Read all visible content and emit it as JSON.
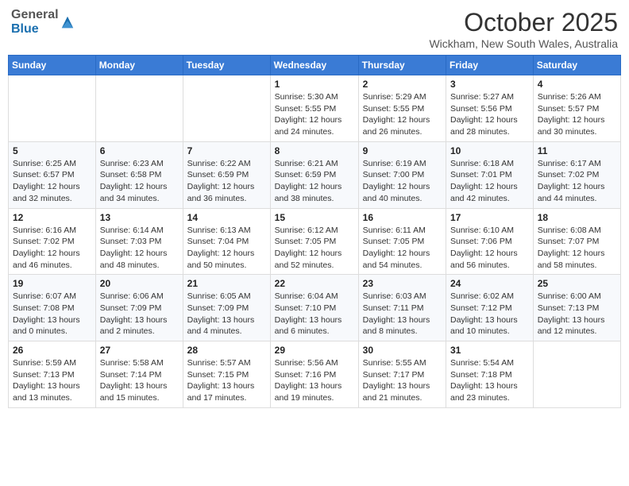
{
  "header": {
    "logo": {
      "general": "General",
      "blue": "Blue"
    },
    "title": "October 2025",
    "location": "Wickham, New South Wales, Australia"
  },
  "weekdays": [
    "Sunday",
    "Monday",
    "Tuesday",
    "Wednesday",
    "Thursday",
    "Friday",
    "Saturday"
  ],
  "weeks": [
    [
      {
        "day": "",
        "info": ""
      },
      {
        "day": "",
        "info": ""
      },
      {
        "day": "",
        "info": ""
      },
      {
        "day": "1",
        "info": "Sunrise: 5:30 AM\nSunset: 5:55 PM\nDaylight: 12 hours\nand 24 minutes."
      },
      {
        "day": "2",
        "info": "Sunrise: 5:29 AM\nSunset: 5:55 PM\nDaylight: 12 hours\nand 26 minutes."
      },
      {
        "day": "3",
        "info": "Sunrise: 5:27 AM\nSunset: 5:56 PM\nDaylight: 12 hours\nand 28 minutes."
      },
      {
        "day": "4",
        "info": "Sunrise: 5:26 AM\nSunset: 5:57 PM\nDaylight: 12 hours\nand 30 minutes."
      }
    ],
    [
      {
        "day": "5",
        "info": "Sunrise: 6:25 AM\nSunset: 6:57 PM\nDaylight: 12 hours\nand 32 minutes."
      },
      {
        "day": "6",
        "info": "Sunrise: 6:23 AM\nSunset: 6:58 PM\nDaylight: 12 hours\nand 34 minutes."
      },
      {
        "day": "7",
        "info": "Sunrise: 6:22 AM\nSunset: 6:59 PM\nDaylight: 12 hours\nand 36 minutes."
      },
      {
        "day": "8",
        "info": "Sunrise: 6:21 AM\nSunset: 6:59 PM\nDaylight: 12 hours\nand 38 minutes."
      },
      {
        "day": "9",
        "info": "Sunrise: 6:19 AM\nSunset: 7:00 PM\nDaylight: 12 hours\nand 40 minutes."
      },
      {
        "day": "10",
        "info": "Sunrise: 6:18 AM\nSunset: 7:01 PM\nDaylight: 12 hours\nand 42 minutes."
      },
      {
        "day": "11",
        "info": "Sunrise: 6:17 AM\nSunset: 7:02 PM\nDaylight: 12 hours\nand 44 minutes."
      }
    ],
    [
      {
        "day": "12",
        "info": "Sunrise: 6:16 AM\nSunset: 7:02 PM\nDaylight: 12 hours\nand 46 minutes."
      },
      {
        "day": "13",
        "info": "Sunrise: 6:14 AM\nSunset: 7:03 PM\nDaylight: 12 hours\nand 48 minutes."
      },
      {
        "day": "14",
        "info": "Sunrise: 6:13 AM\nSunset: 7:04 PM\nDaylight: 12 hours\nand 50 minutes."
      },
      {
        "day": "15",
        "info": "Sunrise: 6:12 AM\nSunset: 7:05 PM\nDaylight: 12 hours\nand 52 minutes."
      },
      {
        "day": "16",
        "info": "Sunrise: 6:11 AM\nSunset: 7:05 PM\nDaylight: 12 hours\nand 54 minutes."
      },
      {
        "day": "17",
        "info": "Sunrise: 6:10 AM\nSunset: 7:06 PM\nDaylight: 12 hours\nand 56 minutes."
      },
      {
        "day": "18",
        "info": "Sunrise: 6:08 AM\nSunset: 7:07 PM\nDaylight: 12 hours\nand 58 minutes."
      }
    ],
    [
      {
        "day": "19",
        "info": "Sunrise: 6:07 AM\nSunset: 7:08 PM\nDaylight: 13 hours\nand 0 minutes."
      },
      {
        "day": "20",
        "info": "Sunrise: 6:06 AM\nSunset: 7:09 PM\nDaylight: 13 hours\nand 2 minutes."
      },
      {
        "day": "21",
        "info": "Sunrise: 6:05 AM\nSunset: 7:09 PM\nDaylight: 13 hours\nand 4 minutes."
      },
      {
        "day": "22",
        "info": "Sunrise: 6:04 AM\nSunset: 7:10 PM\nDaylight: 13 hours\nand 6 minutes."
      },
      {
        "day": "23",
        "info": "Sunrise: 6:03 AM\nSunset: 7:11 PM\nDaylight: 13 hours\nand 8 minutes."
      },
      {
        "day": "24",
        "info": "Sunrise: 6:02 AM\nSunset: 7:12 PM\nDaylight: 13 hours\nand 10 minutes."
      },
      {
        "day": "25",
        "info": "Sunrise: 6:00 AM\nSunset: 7:13 PM\nDaylight: 13 hours\nand 12 minutes."
      }
    ],
    [
      {
        "day": "26",
        "info": "Sunrise: 5:59 AM\nSunset: 7:13 PM\nDaylight: 13 hours\nand 13 minutes."
      },
      {
        "day": "27",
        "info": "Sunrise: 5:58 AM\nSunset: 7:14 PM\nDaylight: 13 hours\nand 15 minutes."
      },
      {
        "day": "28",
        "info": "Sunrise: 5:57 AM\nSunset: 7:15 PM\nDaylight: 13 hours\nand 17 minutes."
      },
      {
        "day": "29",
        "info": "Sunrise: 5:56 AM\nSunset: 7:16 PM\nDaylight: 13 hours\nand 19 minutes."
      },
      {
        "day": "30",
        "info": "Sunrise: 5:55 AM\nSunset: 7:17 PM\nDaylight: 13 hours\nand 21 minutes."
      },
      {
        "day": "31",
        "info": "Sunrise: 5:54 AM\nSunset: 7:18 PM\nDaylight: 13 hours\nand 23 minutes."
      },
      {
        "day": "",
        "info": ""
      }
    ]
  ]
}
